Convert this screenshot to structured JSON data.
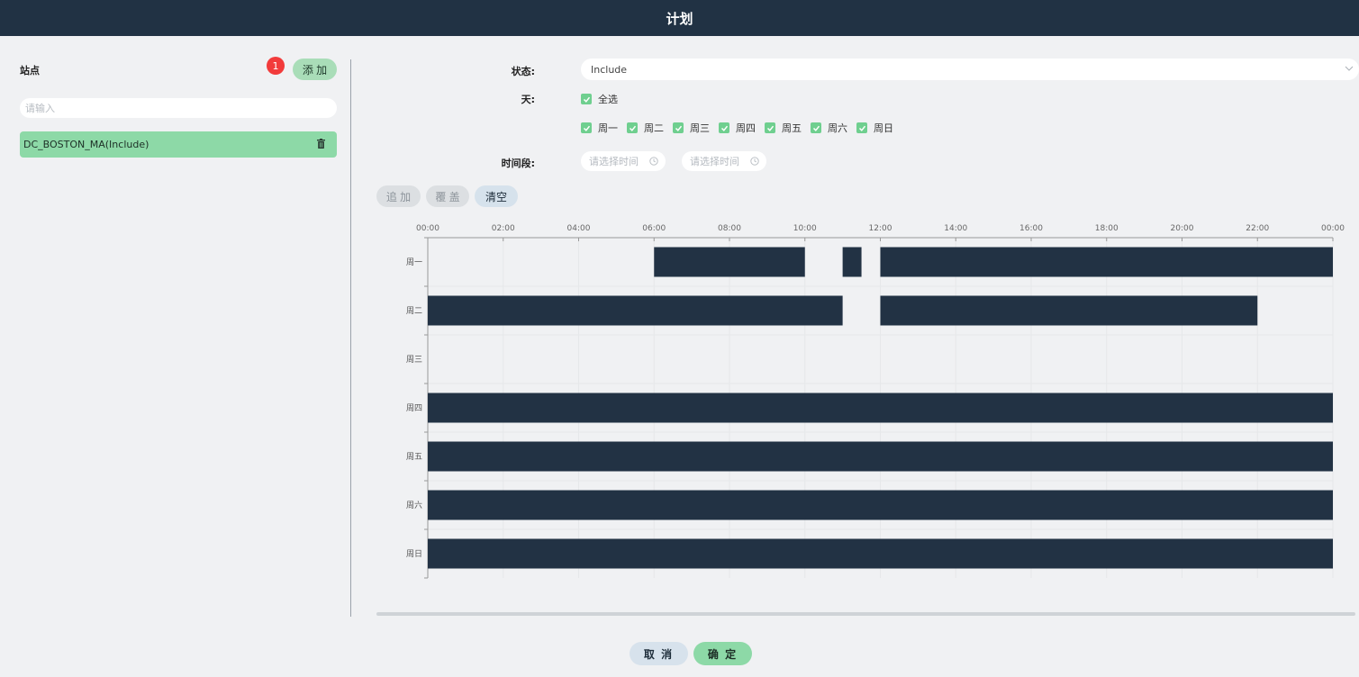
{
  "window": {
    "title": "计划"
  },
  "sites": {
    "label": "站点",
    "badge_count": "1",
    "add_label": "添 加",
    "search_placeholder": "请输入",
    "items": [
      {
        "label": "DC_BOSTON_MA(Include)"
      }
    ]
  },
  "form": {
    "status_label": "状态:",
    "status_value": "Include",
    "days_label": "天:",
    "select_all_label": "全选",
    "day_options": [
      "周一",
      "周二",
      "周三",
      "周四",
      "周五",
      "周六",
      "周日"
    ],
    "time_label": "时间段:",
    "time_start_placeholder": "请选择时间",
    "time_end_placeholder": "请选择时间"
  },
  "actions": {
    "append_label": "追 加",
    "overwrite_label": "覆 盖",
    "clear_label": "清空"
  },
  "chart_data": {
    "type": "bar",
    "orientation": "horizontal-ranges",
    "x_ticks": [
      "00:00",
      "02:00",
      "04:00",
      "06:00",
      "08:00",
      "10:00",
      "12:00",
      "14:00",
      "16:00",
      "18:00",
      "20:00",
      "22:00",
      "00:00"
    ],
    "xlim": [
      0,
      24
    ],
    "categories": [
      "周一",
      "周二",
      "周三",
      "周四",
      "周五",
      "周六",
      "周日"
    ],
    "ranges": [
      [
        [
          6,
          10
        ],
        [
          11,
          11.5
        ],
        [
          12,
          24
        ]
      ],
      [
        [
          0,
          11
        ],
        [
          12,
          22
        ]
      ],
      [],
      [
        [
          0,
          24
        ]
      ],
      [
        [
          0,
          24
        ]
      ],
      [
        [
          0,
          24
        ]
      ],
      [
        [
          0,
          24
        ]
      ]
    ],
    "bar_color": "#223244",
    "grid": true
  },
  "footer": {
    "cancel_label": "取 消",
    "ok_label": "确 定"
  },
  "colors": {
    "header_bg": "#213244",
    "accent_green": "#8dd9a7",
    "badge_red": "#f23b3b"
  }
}
